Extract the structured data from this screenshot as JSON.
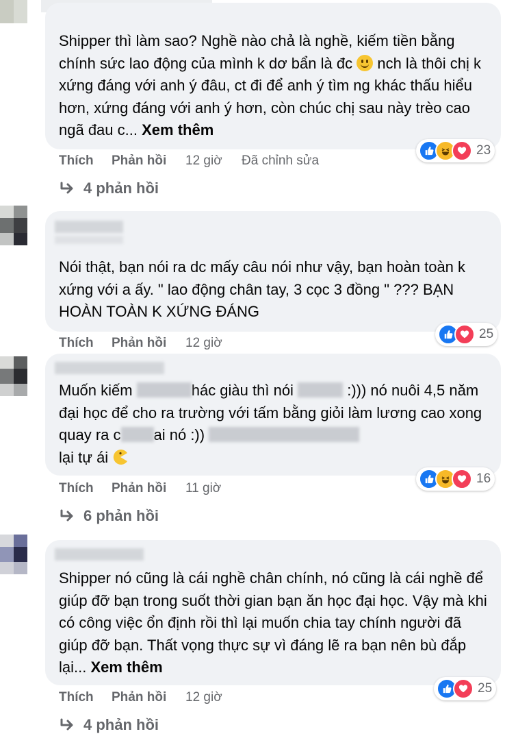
{
  "comments": [
    {
      "text": "Shipper thì làm sao? Nghề nào chả là nghề, kiếm tiền bằng chính sức lao động của mình k dơ bẩn là đc",
      "text_after_emoji": "nch là thôi chị k xứng đáng với anh ý đâu, ct đi để anh ý tìm ng khác thấu hiểu hơn, xứng đáng với anh ý hơn, còn chúc chị sau này trèo cao ngã đau c...",
      "more": "Xem thêm",
      "like": "Thích",
      "reply": "Phản hồi",
      "time": "12 giờ",
      "edited": "Đã chỉnh sửa",
      "reaction_icons": [
        "like-icon",
        "haha-icon",
        "love-icon"
      ],
      "reaction_count": "23",
      "replies": "4 phản hồi"
    },
    {
      "text": "Nói thật, bạn nói ra dc mấy câu nói như vậy, bạn hoàn toàn k xứng với a ấy. \" lao động chân tay, 3 cọc 3 đồng \" ??? BẠN HOÀN TOÀN K XỨNG ĐÁNG",
      "like": "Thích",
      "reply": "Phản hồi",
      "time": "12 giờ",
      "reaction_icons": [
        "like-icon",
        "love-icon"
      ],
      "reaction_count": "25"
    },
    {
      "text_a": "Muốn kiếm",
      "text_b": "hác giàu thì nói",
      "text_c": ":))) nó nuôi 4,5 năm đại học để cho ra trường với tấm bằng giỏi làm lương cao xong quay ra c",
      "text_d": "ai nó :))",
      "text_e": "lại tự ái",
      "like": "Thích",
      "reply": "Phản hồi",
      "time": "11 giờ",
      "reaction_icons": [
        "like-icon",
        "haha-icon",
        "love-icon"
      ],
      "reaction_count": "16",
      "replies": "6 phản hồi"
    },
    {
      "text": "Shipper nó cũng là cái nghề chân chính, nó cũng là cái nghề để giúp đỡ bạn trong suốt thời gian bạn ăn học đại học. Vậy mà khi có công việc ổn định rồi thì lại muốn chia tay chính người đã giúp đỡ bạn. Thất vọng thực sự vì đáng lẽ ra bạn nên bù đắp lại...",
      "more": "Xem thêm",
      "like": "Thích",
      "reply": "Phản hồi",
      "time": "12 giờ",
      "reaction_icons": [
        "like-icon",
        "love-icon"
      ],
      "reaction_count": "25",
      "replies": "4 phản hồi"
    }
  ],
  "colors": {
    "bubble": "#f0f2f5",
    "meta_text": "#65676b",
    "like": "#1877f2",
    "haha": "#f7b928",
    "love": "#f33e58"
  }
}
